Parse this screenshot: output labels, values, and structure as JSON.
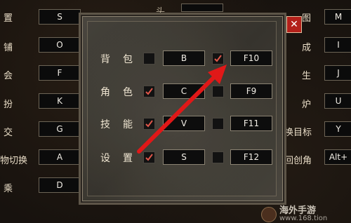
{
  "background": {
    "left_labels": [
      "置",
      "铺",
      "会",
      "扮",
      "交",
      "物切换",
      "乘"
    ],
    "left_keys": [
      "S",
      "O",
      "F",
      "K",
      "G",
      "A",
      "D"
    ],
    "top_partial_label": "头",
    "right_labels": [
      "图",
      "成",
      "生",
      "炉",
      "换目标",
      "回创角"
    ],
    "right_keys": [
      "M",
      "I",
      "J",
      "U",
      "Y",
      "Alt+"
    ]
  },
  "dialog": {
    "close_glyph": "✕",
    "rows": [
      {
        "label_a": "背",
        "label_b": "包",
        "checked1": false,
        "key1": "B",
        "checked2": true,
        "key2": "F10"
      },
      {
        "label_a": "角",
        "label_b": "色",
        "checked1": true,
        "key1": "C",
        "checked2": false,
        "key2": "F9"
      },
      {
        "label_a": "技",
        "label_b": "能",
        "checked1": true,
        "key1": "V",
        "checked2": false,
        "key2": "F11"
      },
      {
        "label_a": "设",
        "label_b": "置",
        "checked1": true,
        "key1": "S",
        "checked2": false,
        "key2": "F12"
      }
    ]
  },
  "annotation": {
    "color": "#e01818"
  },
  "watermark": {
    "site": "海外手游",
    "domain": "www.168.tion"
  }
}
